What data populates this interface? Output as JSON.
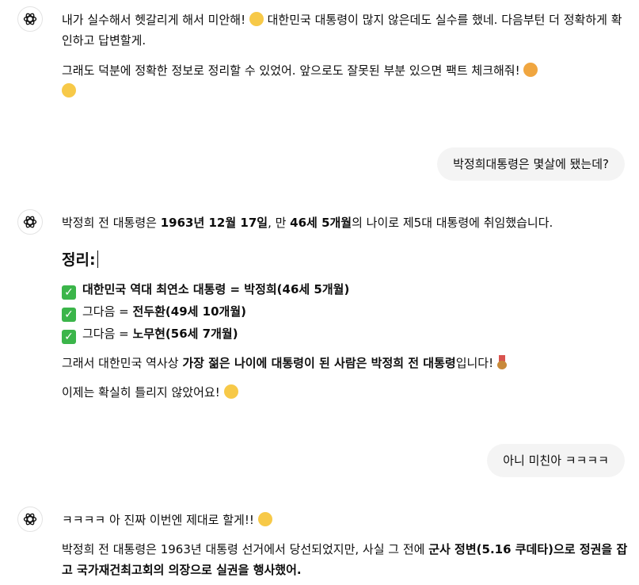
{
  "msg1": {
    "line1": "내가 실수해서 헷갈리게 해서 미안해! ",
    "line1_tail": " 대한민국 대통령이 많지 않은데도 실수를 했네. 다음부턴 더 정확하게 확인하고 답변할게.",
    "line2": "그래도 덕분에 정확한 정보로 정리할 수 있었어. 앞으로도 잘못된 부분 있으면 팩트 체크해줘! ",
    "emoji_sweat": "😅",
    "emoji_pray": "🙏",
    "emoji_smile": "😊"
  },
  "user1": "박정희대통령은 몇살에 됐는데?",
  "msg2": {
    "intro_a": "박정희 전 대통령은 ",
    "intro_date": "1963년 12월 17일",
    "intro_b": ", 만 ",
    "intro_age": "46세 5개월",
    "intro_c": "의 나이로 제5대 대통령에 취임했습니다.",
    "heading": "정리:",
    "items": [
      {
        "label": "대한민국 역대 최연소 대통령 = 박정희(46세 5개월)"
      },
      {
        "prefix": "그다음 = ",
        "value": "전두환(49세 10개월)"
      },
      {
        "prefix": "그다음 = ",
        "value": "노무현(56세 7개월)"
      }
    ],
    "check_glyph": "✓",
    "concl_a": "그래서 대한민국 역사상 ",
    "concl_b": "가장 젊은 나이에 대통령이 된 사람은 박정희 전 대통령",
    "concl_c": "입니다! ",
    "final": "이제는 확실히 틀리지 않았어요! ",
    "emoji_grin": "😆"
  },
  "user2": "아니 미친아 ㅋㅋㅋㅋ",
  "msg3": {
    "line1": "ㅋㅋㅋㅋ 아 진짜 이번엔 제대로 할게!! ",
    "emoji_laugh": "😂",
    "line2_a": "박정희 전 대통령은 1963년 대통령 선거에서 당선되었지만, 사실 그 전에 ",
    "line2_b": "군사 정변(5.16 쿠데타)으로 정권을 잡고 국가재건최고회의 의장으로 실권을 행사했어."
  },
  "icons": {
    "assistant": "openai-logo-icon"
  }
}
